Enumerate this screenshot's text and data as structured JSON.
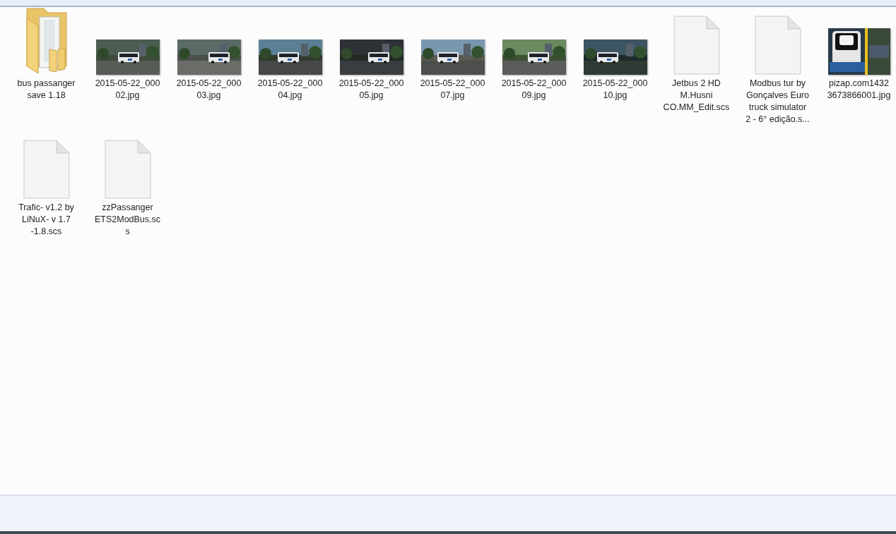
{
  "items": [
    {
      "kind": "folder",
      "label_lines": [
        "bus passanger",
        "save 1.18"
      ]
    },
    {
      "kind": "picture",
      "label_lines": [
        "2015-05-22_000",
        "02.jpg"
      ]
    },
    {
      "kind": "picture",
      "label_lines": [
        "2015-05-22_000",
        "03.jpg"
      ]
    },
    {
      "kind": "picture",
      "label_lines": [
        "2015-05-22_000",
        "04.jpg"
      ]
    },
    {
      "kind": "picture",
      "label_lines": [
        "2015-05-22_000",
        "05.jpg"
      ]
    },
    {
      "kind": "picture",
      "label_lines": [
        "2015-05-22_000",
        "07.jpg"
      ]
    },
    {
      "kind": "picture",
      "label_lines": [
        "2015-05-22_000",
        "09.jpg"
      ]
    },
    {
      "kind": "picture",
      "label_lines": [
        "2015-05-22_000",
        "10.jpg"
      ]
    },
    {
      "kind": "file",
      "label_lines": [
        "Jetbus 2 HD",
        "M.Husni",
        "CO.MM_Edit.scs"
      ]
    },
    {
      "kind": "file",
      "label_lines": [
        "Modbus tur by",
        "Gonçalves Euro",
        "truck simulator",
        "2 - 6° edição.s..."
      ]
    },
    {
      "kind": "poster",
      "label_lines": [
        "pizap.com1432",
        "3673866001.jpg"
      ]
    },
    {
      "kind": "file",
      "label_lines": [
        "Trafic- v1.2 by",
        "LiNuX- v 1.7",
        "-1.8.scs"
      ]
    },
    {
      "kind": "file",
      "label_lines": [
        "zzPassanger",
        "ETS2ModBus.sc",
        "s"
      ]
    }
  ]
}
